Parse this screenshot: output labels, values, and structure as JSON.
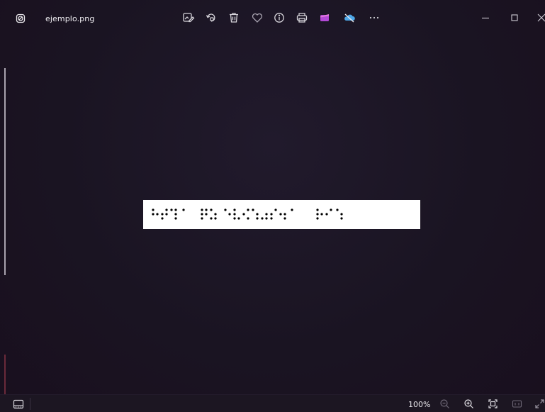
{
  "window": {
    "file_name": "ejemplo.png",
    "app_icon": "photos-app-icon"
  },
  "toolbar": {
    "icons": [
      "edit-image-icon",
      "rotate-icon",
      "delete-icon",
      "favorite-heart-icon",
      "file-info-icon",
      "print-icon",
      "clipchamp-icon",
      "onedrive-sync-off-icon",
      "more-options-icon"
    ]
  },
  "window_controls": [
    "minimize-icon",
    "maximize-icon",
    "close-icon"
  ],
  "statusbar": {
    "zoom_level": "100%",
    "icons": [
      "filmstrip-icon",
      "zoom-out-icon",
      "zoom-in-icon",
      "fit-to-window-icon",
      "actual-size-icon",
      "fullscreen-icon"
    ]
  },
  "colors": {
    "background": "#1a1420",
    "image_background": "#ffffff",
    "braille_dots": "#000000",
    "clipchamp_accent": "#b349d6",
    "onedrive_accent": "#4ea8e8"
  }
}
